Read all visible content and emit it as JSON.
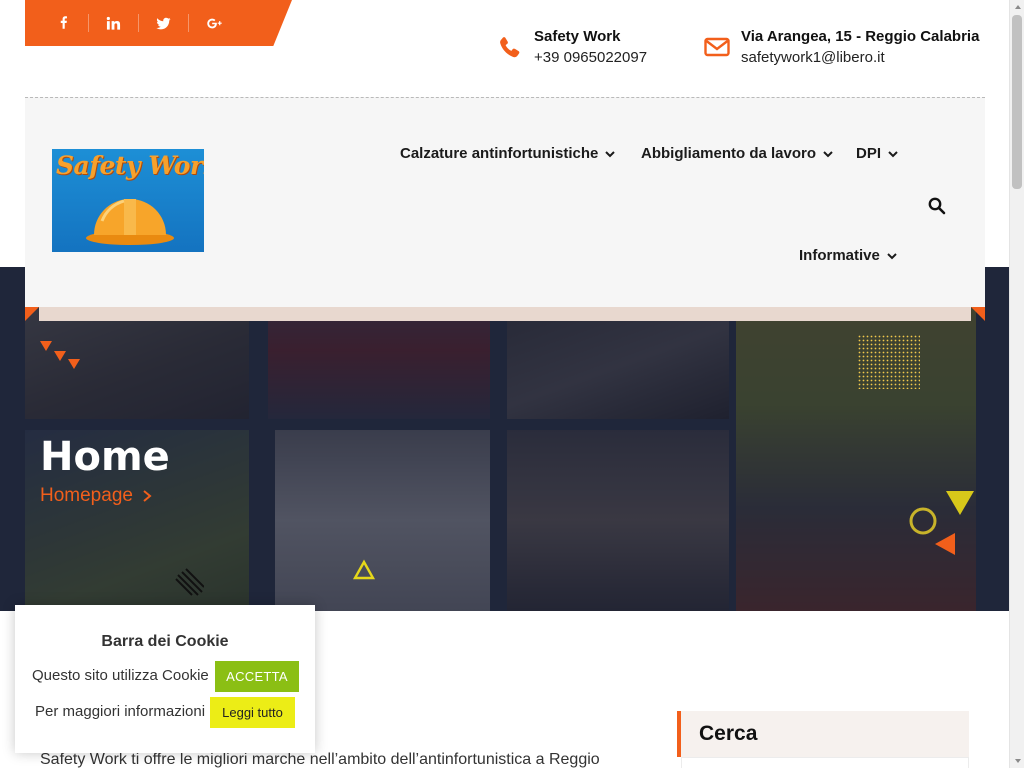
{
  "colors": {
    "accent": "#f25f1b",
    "accept_button": "#8bbf14",
    "read_more_button": "#eced16",
    "hero_overlay": "#1c2038"
  },
  "social": [
    {
      "name": "facebook-icon",
      "glyph": "f"
    },
    {
      "name": "linkedin-icon",
      "glyph": "in"
    },
    {
      "name": "twitter-icon",
      "glyph": "t"
    },
    {
      "name": "google-plus-icon",
      "glyph": "g+"
    }
  ],
  "contact": {
    "phone": {
      "icon": "phone-icon",
      "title": "Safety Work",
      "text": "+39 0965022097"
    },
    "email": {
      "icon": "envelope-icon",
      "title": "Via Arangea, 15 - Reggio Calabria",
      "text": "safetywork1@libero.it"
    }
  },
  "logo": {
    "text": "Safety Work",
    "icon": "hard-hat-icon"
  },
  "nav": {
    "items": [
      {
        "label": "Calzature antinfortunistiche"
      },
      {
        "label": "Abbigliamento da lavoro"
      },
      {
        "label": "DPI"
      },
      {
        "label": "Informative"
      }
    ],
    "search_icon": "search-icon"
  },
  "hero": {
    "title": "Home",
    "breadcrumb": "Homepage"
  },
  "cookie": {
    "title": "Barra dei Cookie",
    "line1": "Questo sito utilizza Cookie",
    "accept_label": "ACCETTA",
    "line2": "Per maggiori informazioni",
    "read_more_label": "Leggi tutto"
  },
  "content": {
    "intro": "Safety Work ti offre le migliori marche nell’ambito dell’antinfortunistica a Reggio"
  },
  "sidebar": {
    "search_widget_title": "Cerca"
  }
}
